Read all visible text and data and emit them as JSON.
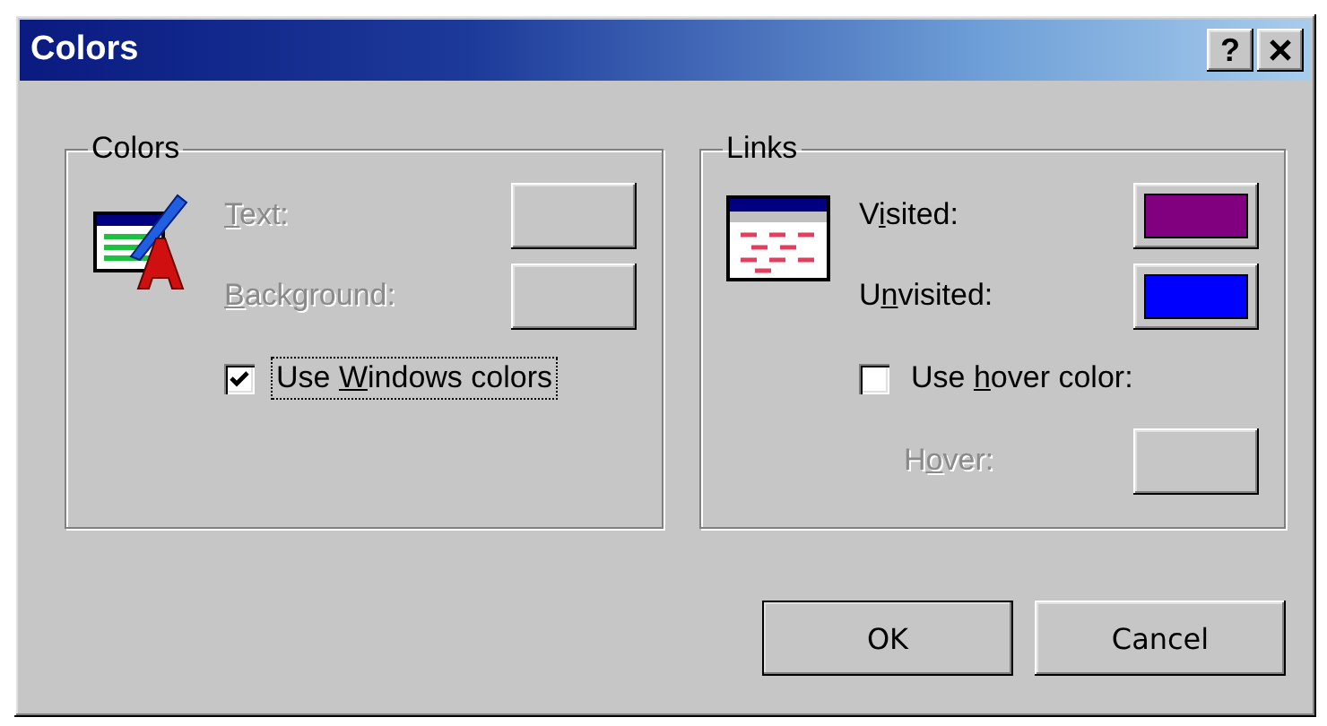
{
  "window": {
    "title": "Colors",
    "help_button": "?"
  },
  "groups": [
    {
      "title": "Colors",
      "rows": [
        {
          "kind": "color",
          "label": {
            "key": "T",
            "after": "ext:"
          },
          "disabled": true
        },
        {
          "kind": "color",
          "label": {
            "key": "B",
            "after": "ackground:"
          },
          "disabled": true
        },
        {
          "kind": "checkbox",
          "label": {
            "before": "Use ",
            "key": "W",
            "after": "indows colors"
          },
          "checked": true,
          "focused": true
        }
      ]
    },
    {
      "title": "Links",
      "rows": [
        {
          "kind": "color",
          "label": {
            "before": "V",
            "key": "i",
            "after": "sited:"
          },
          "disabled": false,
          "color": "#800080"
        },
        {
          "kind": "color",
          "label": {
            "before": "U",
            "key": "n",
            "after": "visited:"
          },
          "disabled": false,
          "color": "#0000ff"
        },
        {
          "kind": "checkbox",
          "label": {
            "before": "Use ",
            "key": "h",
            "after": "over color:"
          },
          "checked": false,
          "focused": false
        },
        {
          "kind": "color",
          "label": {
            "before": "H",
            "key": "o",
            "after": "ver:"
          },
          "disabled": true
        }
      ]
    }
  ],
  "buttons": [
    {
      "label": "OK",
      "default": true
    },
    {
      "label": "Cancel",
      "default": false
    }
  ]
}
